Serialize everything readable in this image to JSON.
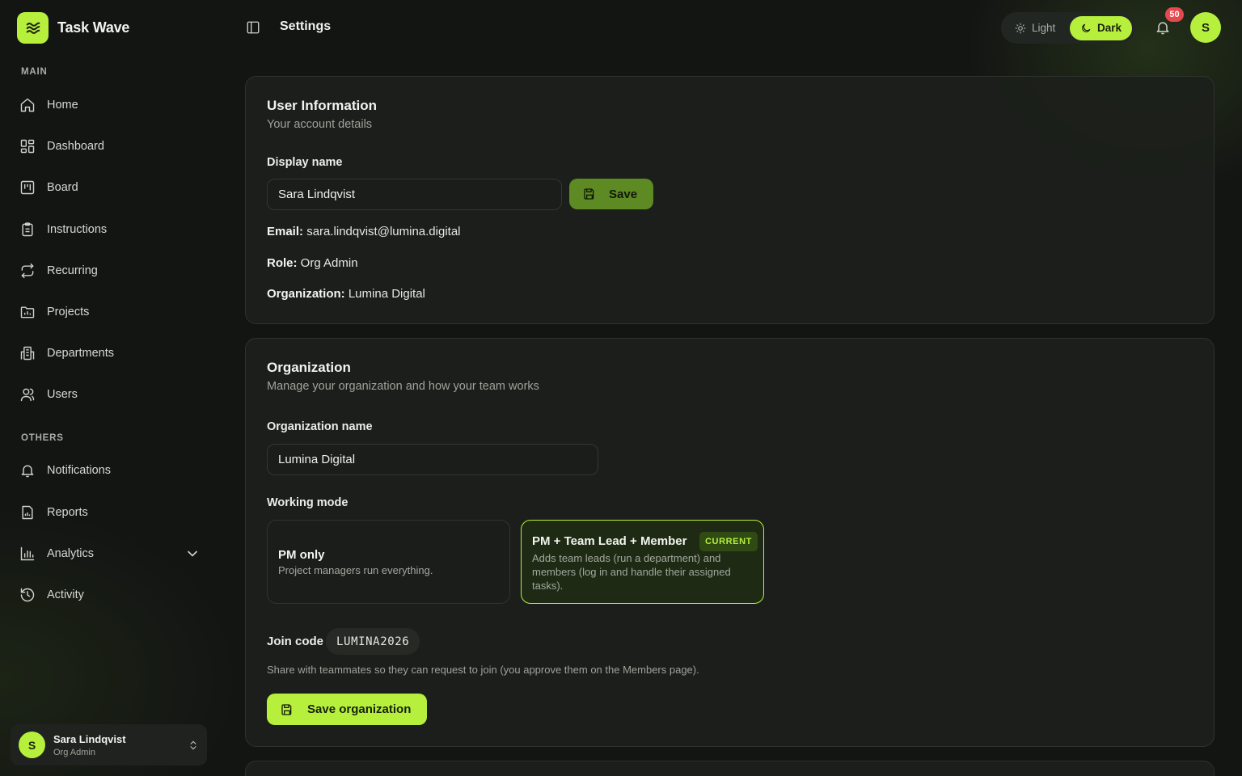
{
  "app": {
    "name": "Task Wave"
  },
  "colors": {
    "accent": "#b6f03c",
    "background": "#131513",
    "badge": "#e5484d"
  },
  "sidebar": {
    "sections": [
      {
        "label": "MAIN"
      },
      {
        "label": "OTHERS"
      }
    ],
    "main_items": [
      {
        "label": "Home",
        "icon": "home-icon"
      },
      {
        "label": "Dashboard",
        "icon": "dashboard-icon"
      },
      {
        "label": "Board",
        "icon": "board-icon"
      },
      {
        "label": "Instructions",
        "icon": "clipboard-icon"
      },
      {
        "label": "Recurring",
        "icon": "repeat-icon"
      },
      {
        "label": "Projects",
        "icon": "folder-chart-icon"
      },
      {
        "label": "Departments",
        "icon": "building-icon"
      },
      {
        "label": "Users",
        "icon": "users-icon"
      }
    ],
    "other_items": [
      {
        "label": "Notifications",
        "icon": "bell-icon"
      },
      {
        "label": "Reports",
        "icon": "report-icon"
      },
      {
        "label": "Analytics",
        "icon": "bar-chart-icon"
      },
      {
        "label": "Activity",
        "icon": "history-icon"
      }
    ],
    "user": {
      "initial": "S",
      "name": "Sara Lindqvist",
      "role": "Org Admin"
    }
  },
  "header": {
    "title": "Settings",
    "theme": {
      "light_label": "Light",
      "dark_label": "Dark",
      "selected": "Dark"
    },
    "notifications_count": "50",
    "avatar_initial": "S"
  },
  "user_info": {
    "title": "User Information",
    "subtitle": "Your account details",
    "display_name_label": "Display name",
    "display_name_value": "Sara Lindqvist",
    "save_label": "Save",
    "email_label": "Email:",
    "email_value": "sara.lindqvist@lumina.digital",
    "role_label": "Role:",
    "role_value": "Org Admin",
    "org_label": "Organization:",
    "org_value": "Lumina Digital"
  },
  "organization": {
    "title": "Organization",
    "subtitle": "Manage your organization and how your team works",
    "name_label": "Organization name",
    "name_value": "Lumina Digital",
    "working_mode_label": "Working mode",
    "modes": [
      {
        "title": "PM only",
        "description": "Project managers run everything."
      },
      {
        "title": "PM + Team Lead + Member",
        "description": "Adds team leads (run a department) and members (log in and handle their assigned tasks).",
        "tag": "CURRENT"
      }
    ],
    "join_code_label": "Join code",
    "join_code_value": "LUMINA2026",
    "join_help": "Share with teammates so they can request to join (you approve them on the Members page).",
    "save_label": "Save organization"
  }
}
